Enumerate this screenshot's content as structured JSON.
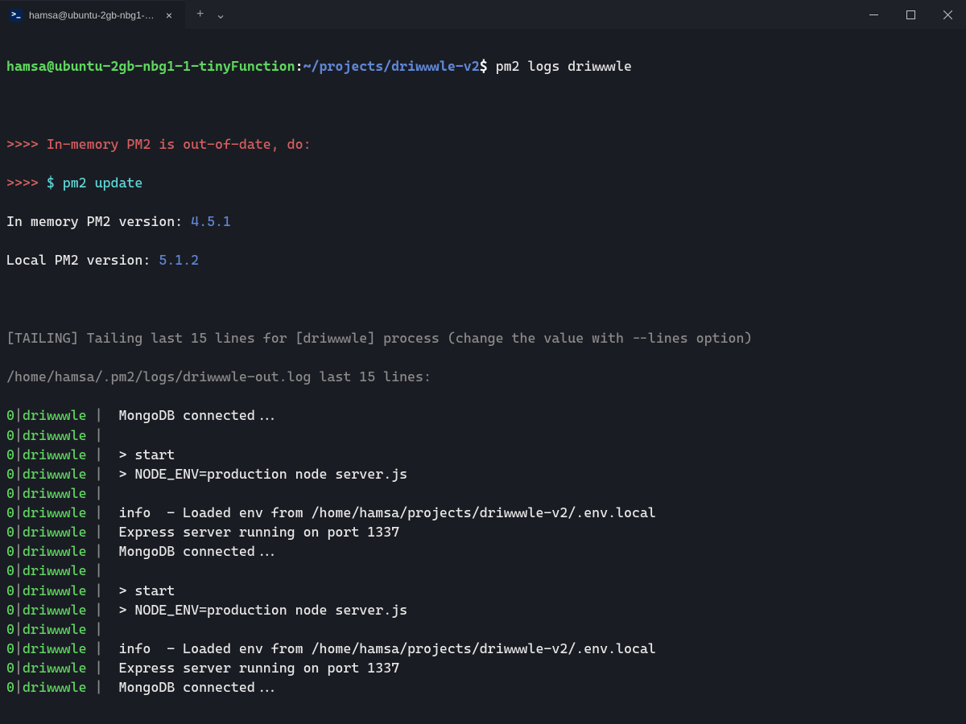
{
  "titlebar": {
    "tab_title": "hamsa@ubuntu-2gb-nbg1-1-tinyFunction",
    "tab_icon_glyph": ">_",
    "close_glyph": "×",
    "new_tab_glyph": "+",
    "dropdown_glyph": "⌄"
  },
  "prompt": {
    "user_host": "hamsa@ubuntu-2gb-nbg1-1-tinyFunction",
    "colon": ":",
    "path": "~/projects/driwwwle-v2",
    "dollar": "$",
    "command": " pm2 logs driwwwle"
  },
  "pm2_notice": {
    "line1_prefix": ">>>> ",
    "line1_text": "In-memory PM2 is out-of-date, do:",
    "line2_prefix": ">>>> ",
    "line2_text": "$ pm2 update",
    "mem_label": "In memory PM2 version: ",
    "mem_version": "4.5.1",
    "local_label": "Local PM2 version: ",
    "local_version": "5.1.2"
  },
  "tailing": {
    "header": "[TAILING] Tailing last 15 lines for [driwwwle] process (change the value with --lines option)",
    "logpath": "/home/hamsa/.pm2/logs/driwwwle-out.log last 15 lines:"
  },
  "log_prefix_num": "0",
  "log_prefix_name": "driwwwle",
  "log_prefix_sep": "|",
  "log_prefix_bar": " | ",
  "logs": [
    " MongoDB connected...",
    "",
    " > start",
    " > NODE_ENV=production node server.js",
    "",
    " info  - Loaded env from /home/hamsa/projects/driwwwle-v2/.env.local",
    " Express server running on port 1337",
    " MongoDB connected...",
    "",
    " > start",
    " > NODE_ENV=production node server.js",
    "",
    " info  - Loaded env from /home/hamsa/projects/driwwwle-v2/.env.local",
    " Express server running on port 1337",
    " MongoDB connected..."
  ]
}
